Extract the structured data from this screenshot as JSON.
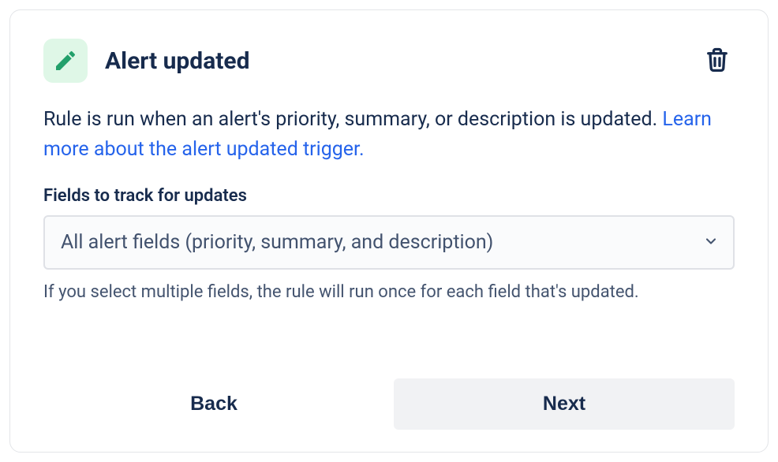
{
  "header": {
    "title": "Alert updated"
  },
  "description": {
    "text": "Rule is run when an alert's priority, summary, or description is updated. ",
    "link_text": "Learn more about the alert updated trigger."
  },
  "field": {
    "label": "Fields to track for updates",
    "selected": "All alert fields (priority, summary, and description)",
    "helper": "If you select multiple fields, the rule will run once for each field that's updated."
  },
  "buttons": {
    "back": "Back",
    "next": "Next"
  }
}
